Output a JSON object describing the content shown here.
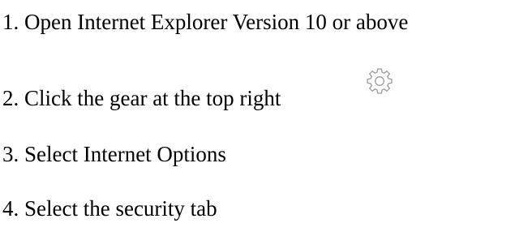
{
  "steps": [
    {
      "text": "1. Open Internet Explorer Version 10 or above"
    },
    {
      "text": "2. Click the gear at the top right",
      "icon": "gear-icon"
    },
    {
      "text": "3. Select Internet Options"
    },
    {
      "text": "4. Select the security tab"
    }
  ],
  "colors": {
    "text": "#000000",
    "gear_icon": "#9a9a9a",
    "background": "#ffffff"
  }
}
